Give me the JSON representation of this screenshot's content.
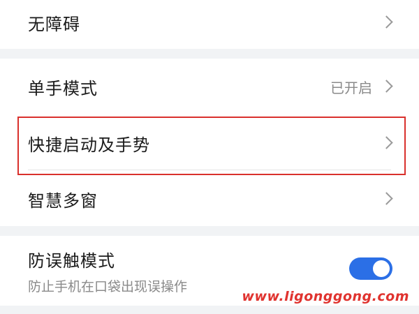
{
  "settings": {
    "accessibility": {
      "label": "无障碍"
    },
    "one_handed_mode": {
      "label": "单手模式",
      "status": "已开启"
    },
    "shortcuts_gestures": {
      "label": "快捷启动及手势"
    },
    "smart_multi_window": {
      "label": "智慧多窗"
    },
    "accidental_touch": {
      "label": "防误触模式",
      "description": "防止手机在口袋出现误操作",
      "enabled": true
    }
  },
  "colors": {
    "accent": "#2b6fe6",
    "highlight": "#d9302c",
    "background": "#f1f3f5"
  },
  "watermark": {
    "text": "www.ligonggong.com"
  }
}
